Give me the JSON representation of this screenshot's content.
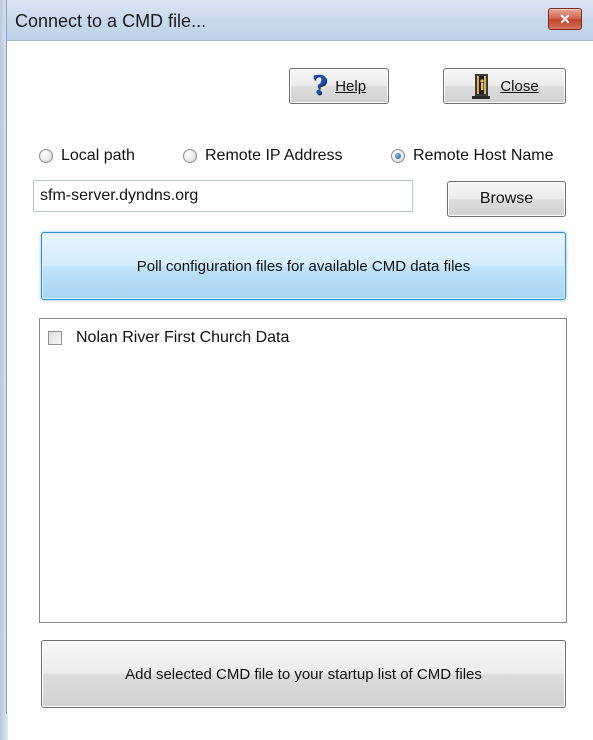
{
  "window": {
    "title": "Connect to a CMD file...",
    "close_glyph": "✕"
  },
  "toolbar": {
    "help_label": "Help",
    "help_icon": "question-mark-icon",
    "close_label": "Close",
    "close_icon": "door-exit-icon"
  },
  "connection": {
    "options": [
      {
        "label": "Local path",
        "checked": false
      },
      {
        "label": "Remote IP Address",
        "checked": false
      },
      {
        "label": "Remote Host Name",
        "checked": true
      }
    ],
    "path_value": "sfm-server.dyndns.org",
    "browse_label": "Browse"
  },
  "poll_label": "Poll configuration files for available CMD data files",
  "file_list": {
    "items": [
      {
        "label": "Nolan River First Church Data",
        "checked": false
      }
    ]
  },
  "add_label": "Add selected CMD file to your startup list of CMD files",
  "colors": {
    "titlebar": "#c9d9ec",
    "poll_accent": "#bfe2f8",
    "close_red": "#c0432a"
  }
}
